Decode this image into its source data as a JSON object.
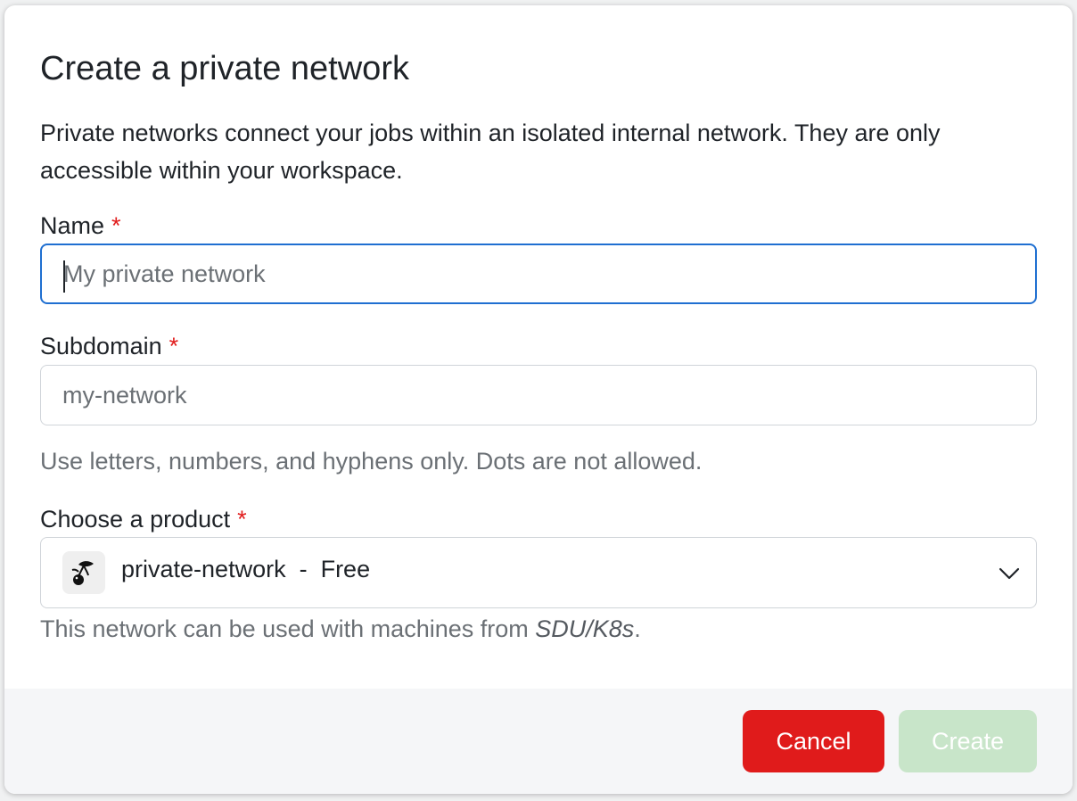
{
  "dialog": {
    "title": "Create a private network",
    "description": "Private networks connect your jobs within an isolated internal network. They are only accessible within your workspace."
  },
  "name_field": {
    "label": "Name",
    "required_marker": "*",
    "placeholder": "My private network",
    "value": ""
  },
  "subdomain_field": {
    "label": "Subdomain",
    "required_marker": "*",
    "placeholder": "my-network",
    "value": "",
    "hint": "Use letters, numbers, and hyphens only. Dots are not allowed."
  },
  "product_field": {
    "label": "Choose a product",
    "required_marker": "*",
    "selected_product": "private-network",
    "separator": "  -  ",
    "selected_price": "Free",
    "icon": "cherry-icon",
    "hint_prefix": "This network can be used with machines from ",
    "hint_provider": "SDU/K8s",
    "hint_suffix": "."
  },
  "footer": {
    "cancel_label": "Cancel",
    "create_label": "Create"
  },
  "colors": {
    "accent_focus": "#1f6fd1",
    "required": "#e11d1d",
    "cancel_bg": "#e01b1b",
    "create_disabled_bg": "#c8e5c9"
  }
}
